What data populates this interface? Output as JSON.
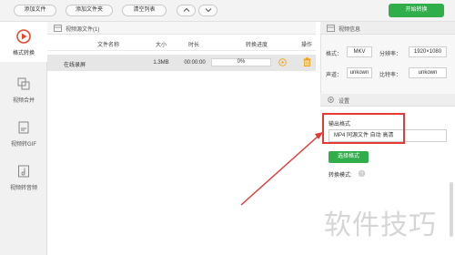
{
  "toolbar": {
    "add_file": "添加文件",
    "add_folder": "添加文件夹",
    "clear_list": "清空列表",
    "start_convert": "开始转换"
  },
  "sidebar": {
    "items": [
      {
        "label": "格式转换",
        "icon": "format-convert-icon",
        "active": true
      },
      {
        "label": "视频合并",
        "icon": "video-merge-icon"
      },
      {
        "label": "视频转GIF",
        "icon": "video-to-gif-icon"
      },
      {
        "label": "视频转音频",
        "icon": "video-to-audio-icon"
      }
    ]
  },
  "file_list": {
    "title": "视频源文件(1)",
    "columns": [
      "文件名称",
      "大小",
      "时长",
      "转换进度",
      "操作"
    ],
    "rows": [
      {
        "name": "在线录屏",
        "size": "1.3MB",
        "duration": "00:00:00",
        "progress": "0%"
      }
    ]
  },
  "video_info": {
    "title": "视频信息",
    "format_label": "格式：",
    "format": "MKV",
    "resolution_label": "分辨率：",
    "resolution": "1920×1080",
    "audio_label": "声道：",
    "audio": "unkown",
    "bitrate_label": "比特率：",
    "bitrate": "unkown"
  },
  "settings": {
    "title": "设置",
    "output_format_label": "输出格式",
    "output_format_value": "MP4 同源文件 自动 高清",
    "choose_format": "选择格式",
    "mode_label": "转换模式:"
  },
  "watermark": "软件技巧",
  "colors": {
    "accent_green": "#2fae4a",
    "highlight_red": "#e53935",
    "icon_red": "#e8472a",
    "delete_orange": "#f0a21d"
  }
}
